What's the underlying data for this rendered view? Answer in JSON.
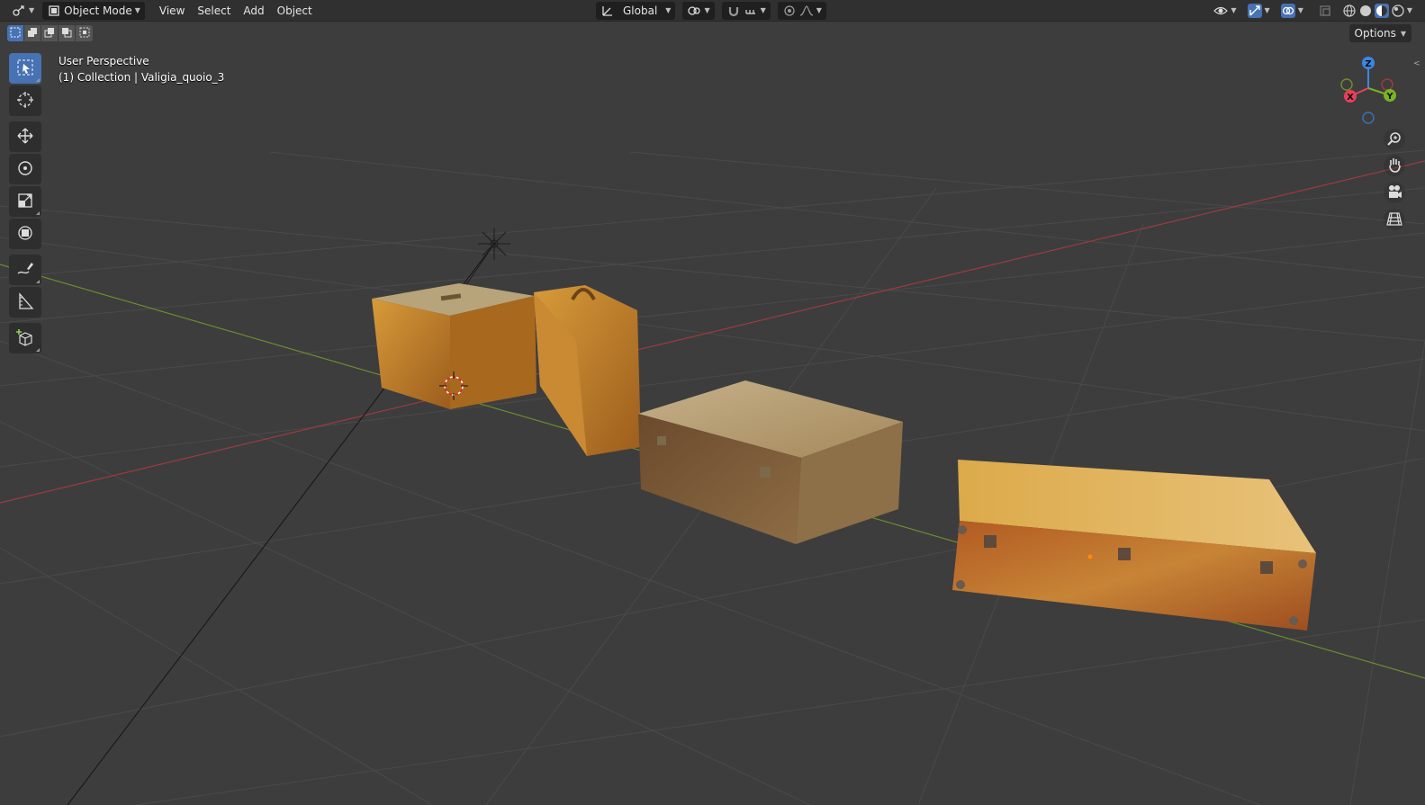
{
  "header": {
    "mode_label": "Object Mode",
    "menus": [
      "View",
      "Select",
      "Add",
      "Object"
    ],
    "transform_orientation": "Global"
  },
  "subbar": {
    "options_label": "Options"
  },
  "viewport": {
    "view_name": "User Perspective",
    "collection_info": "(1) Collection | Valigia_quoio_3"
  },
  "gizmo": {
    "x_label": "X",
    "y_label": "Y",
    "z_label": "Z",
    "x_color": "#e8405a",
    "y_color": "#78b424",
    "z_color": "#3c86e5"
  },
  "colors": {
    "header_bg": "#303030",
    "viewport_bg": "#3d3d3d",
    "active_tool": "#4772b3",
    "x_axis_line": "#9c3b40",
    "y_axis_line": "#6a8d2f"
  },
  "tools": [
    "select-box-icon",
    "cursor-icon",
    "move-icon",
    "rotate-icon",
    "scale-icon",
    "transform-icon",
    "annotate-icon",
    "measure-icon",
    "add-cube-icon"
  ]
}
